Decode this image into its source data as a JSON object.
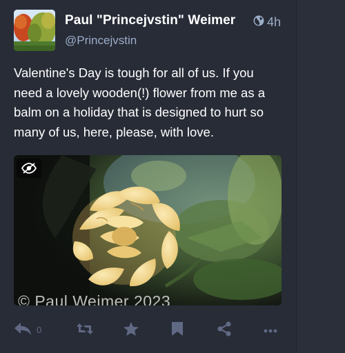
{
  "status": {
    "display_name": "Paul \"Princejvstin\" Weimer",
    "account": "@Princejvstin",
    "visibility_icon": "globe-icon",
    "timestamp": "4h",
    "content": "Valentine's Day is tough for all of us. If you need a lovely wooden(!) flower from me as a balm on a holiday that is designed to hurt so many of us, here, please, with love.",
    "media": {
      "watermark": "© Paul Weimer 2023",
      "hide_icon": "eye-slash-icon"
    },
    "actions": {
      "reply_count": "0",
      "icons": [
        "reply-icon",
        "boost-icon",
        "favourite-icon",
        "bookmark-icon",
        "share-icon",
        "more-icon"
      ]
    }
  },
  "colors": {
    "background": "#282c37",
    "muted_text": "#9baec8",
    "action_icon": "#606984",
    "flower": "#f3d98f"
  }
}
